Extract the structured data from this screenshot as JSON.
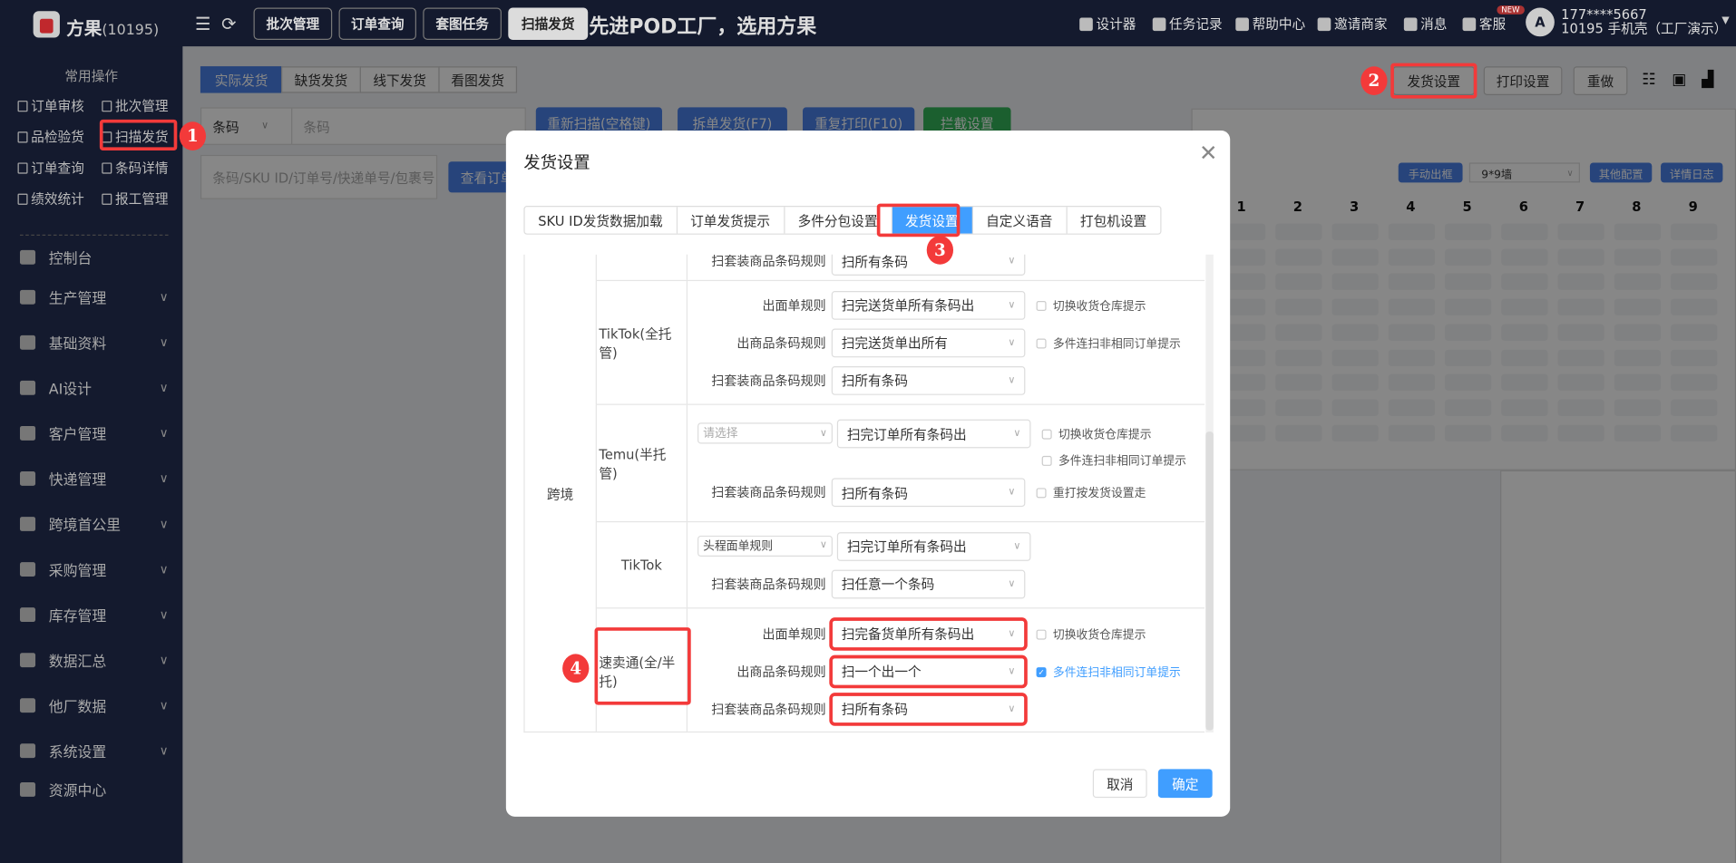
{
  "header": {
    "brand": "方果",
    "brand_id": "(10195)",
    "tabs": [
      "批次管理",
      "订单查询",
      "套图任务",
      "扫描发货"
    ],
    "active_tab": "扫描发货",
    "slogan": "先进POD工厂，选用方果",
    "items": [
      {
        "icon": "image-icon",
        "label": "设计器"
      },
      {
        "icon": "list-icon",
        "label": "任务记录"
      },
      {
        "icon": "help-icon",
        "label": "帮助中心"
      },
      {
        "icon": "user-icon",
        "label": "邀请商家"
      },
      {
        "icon": "message-icon",
        "label": "消息"
      },
      {
        "icon": "headset-icon",
        "label": "客服"
      }
    ],
    "new_badge": "NEW",
    "user_phone": "177****5667",
    "user_org": "10195 手机壳（工厂演示）"
  },
  "sidebar": {
    "quick_title": "常用操作",
    "quick": [
      "订单审核",
      "批次管理",
      "品检验货",
      "扫描发货",
      "订单查询",
      "条码详情",
      "绩效统计",
      "报工管理"
    ],
    "menu": [
      {
        "label": "控制台",
        "chev": false
      },
      {
        "label": "生产管理",
        "chev": true
      },
      {
        "label": "基础资料",
        "chev": true
      },
      {
        "label": "AI设计",
        "chev": true
      },
      {
        "label": "客户管理",
        "chev": true
      },
      {
        "label": "快递管理",
        "chev": true
      },
      {
        "label": "跨境首公里",
        "chev": true
      },
      {
        "label": "采购管理",
        "chev": true
      },
      {
        "label": "库存管理",
        "chev": true
      },
      {
        "label": "数据汇总",
        "chev": true
      },
      {
        "label": "他厂数据",
        "chev": true
      },
      {
        "label": "系统设置",
        "chev": true
      },
      {
        "label": "资源中心",
        "chev": false
      }
    ]
  },
  "main": {
    "subtabs": [
      "实际发货",
      "缺货发货",
      "线下发货",
      "看图发货"
    ],
    "active_subtab": "实际发货",
    "barcode_select": "条码",
    "barcode_placeholder": "条码",
    "actions": [
      "重新扫描(空格键)",
      "拆单发货(F7)",
      "重复打印(F10)",
      "拦截设置"
    ],
    "search_placeholder": "条码/SKU ID/订单号/快递单号/包裹号",
    "view_order": "查看订单",
    "right_buttons": [
      "发货设置",
      "打印设置",
      "重做"
    ],
    "panel_buttons": [
      "手动出框",
      "其他配置",
      "详情日志"
    ],
    "wall_select": "9*9墙",
    "grid_cols": [
      "1",
      "2",
      "3",
      "4",
      "5",
      "6",
      "7",
      "8",
      "9"
    ]
  },
  "annotations": {
    "accent": "#f33a3a",
    "labels": [
      "1",
      "2",
      "3",
      "4"
    ]
  },
  "modal": {
    "title": "发货设置",
    "tabs": [
      "SKU ID发货数据加载",
      "订单发货提示",
      "多件分包设置",
      "发货设置",
      "自定义语音",
      "打包机设置"
    ],
    "active_tab": "发货设置",
    "region": "跨境",
    "partial_row": {
      "label": "扫套装商品条码规则",
      "value": "扫所有条码"
    },
    "rows": [
      {
        "platform": "TikTok(全托管)",
        "lines": [
          {
            "label": "出面单规则",
            "value": "扫完送货单所有条码出",
            "checks": [
              {
                "label": "切换收货仓库提示",
                "checked": false
              }
            ]
          },
          {
            "label": "出商品条码规则",
            "value": "扫完送货单出所有",
            "checks": [
              {
                "label": "多件连扫非相同订单提示",
                "checked": false
              }
            ]
          },
          {
            "label": "扫套装商品条码规则",
            "value": "扫所有条码",
            "checks": []
          }
        ]
      },
      {
        "platform": "Temu(半托管)",
        "lines": [
          {
            "pre_select": "请选择",
            "pre_placeholder": true,
            "value": "扫完订单所有条码出",
            "checks": [
              {
                "label": "切换收货仓库提示",
                "checked": false
              },
              {
                "label": "多件连扫非相同订单提示",
                "checked": false
              }
            ]
          },
          {
            "label": "扫套装商品条码规则",
            "value": "扫所有条码",
            "checks": [
              {
                "label": "重打按发货设置走",
                "checked": false
              }
            ]
          }
        ]
      },
      {
        "platform": "TikTok",
        "lines": [
          {
            "pre_select": "头程面单规则",
            "pre_placeholder": false,
            "value": "扫完订单所有条码出",
            "checks": []
          },
          {
            "label": "扫套装商品条码规则",
            "value": "扫任意一个条码",
            "checks": []
          }
        ]
      },
      {
        "platform": "速卖通(全/半托)",
        "highlight": true,
        "lines": [
          {
            "label": "出面单规则",
            "value": "扫完备货单所有条码出",
            "checks": [
              {
                "label": "切换收货仓库提示",
                "checked": false
              }
            ]
          },
          {
            "label": "出商品条码规则",
            "value": "扫一个出一个",
            "checks": [
              {
                "label": "多件连扫非相同订单提示",
                "checked": true
              }
            ]
          },
          {
            "label": "扫套装商品条码规则",
            "value": "扫所有条码",
            "checks": []
          }
        ]
      }
    ],
    "cancel": "取消",
    "confirm": "确定"
  }
}
